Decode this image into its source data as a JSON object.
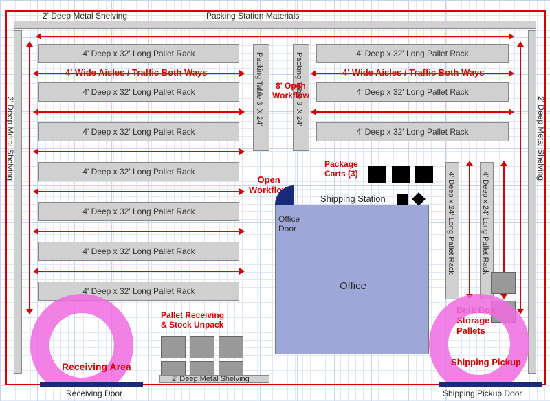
{
  "top": {
    "shelving": "2' Deep Metal Shelving",
    "packing": "Packing Station Materials"
  },
  "side": "2' Deep Metal Shelving",
  "rack32": "4' Deep x 32' Long Pallet Rack",
  "aisle": "4' Wide Aisles / Traffic Both Ways",
  "packingTable": "Packing Table 3' X 24'",
  "openWorkflow": "8' Open\nWorkflow",
  "openWorkflow2": "Open\nWorkflow",
  "packageCarts": "Package\nCarts (3)",
  "shippingStation": "Shipping Station",
  "officeDoor": "Office\nDoor",
  "office": "Office",
  "vrack24": "4' Deep x 24' Long Pallet Rack",
  "bulkBox": "Bulk Box\nStorage\nPallets",
  "palletReceiving": "Pallet Receiving\n& Stock Unpack",
  "receivingArea": "Receiving Area",
  "shelving2": "2' Deep Metal Shelving",
  "receivingDoor": "Receiving Door",
  "shippingPickup": "Shipping Pickup",
  "shippingPickupDoor": "Shipping Pickup Door"
}
